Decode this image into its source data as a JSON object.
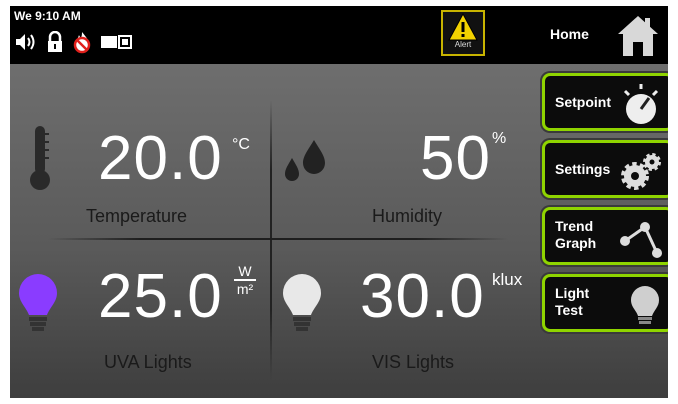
{
  "status_bar": {
    "time": "We 9:10 AM",
    "icons": [
      "speaker-icon",
      "lock-icon",
      "no-fire-icon",
      "battery-icon"
    ]
  },
  "alert": {
    "label": "Alert",
    "color": "#f2d200"
  },
  "home": {
    "label": "Home"
  },
  "readings": {
    "temperature": {
      "value": "20.0",
      "unit": "°C",
      "label": "Temperature"
    },
    "humidity": {
      "value": "50",
      "unit": "%",
      "label": "Humidity"
    },
    "uva": {
      "value": "25.0",
      "unit_top": "W",
      "unit_bottom": "m²",
      "label": "UVA Lights",
      "color": "#8a3cff"
    },
    "vis": {
      "value": "30.0",
      "unit": "klux",
      "label": "VIS Lights"
    }
  },
  "sidebar": {
    "setpoint": {
      "label": "Setpoint"
    },
    "settings": {
      "label": "Settings"
    },
    "trend": {
      "line1": "Trend",
      "line2": "Graph"
    },
    "light_test": {
      "line1": "Light",
      "line2": "Test"
    },
    "accent": "#8fd400"
  }
}
